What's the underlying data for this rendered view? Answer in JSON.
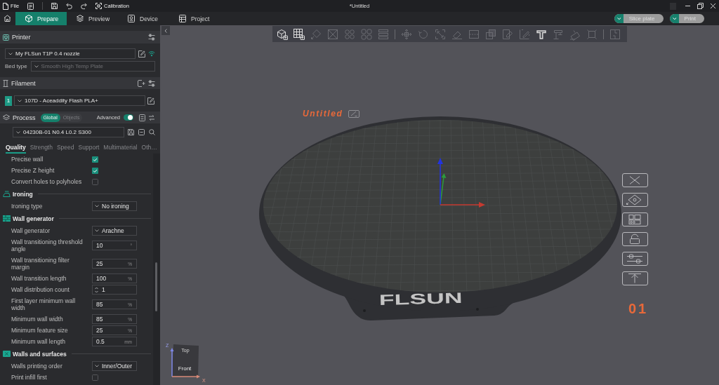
{
  "title_bar": {
    "menu": "File",
    "calibration": "Calibration",
    "title": "*Untitled"
  },
  "tabs": [
    {
      "label": "Prepare",
      "selected": true
    },
    {
      "label": "Preview",
      "selected": false
    },
    {
      "label": "Device",
      "selected": false
    },
    {
      "label": "Project",
      "selected": false
    }
  ],
  "actions": [
    {
      "label": "Slice plate",
      "disabled": true
    },
    {
      "label": "Print",
      "disabled": true
    }
  ],
  "printer": {
    "title": "Printer",
    "preset": "My FLSun T1P 0.4 nozzle",
    "bed_type": {
      "label": "Bed type",
      "value": "Smooth High Temp Plate",
      "disabled": true
    }
  },
  "filament": {
    "title": "Filament",
    "slots": [
      {
        "number": "1",
        "preset": "107D - Aceaddity Flash PLA+",
        "color": "#1e9a85"
      }
    ]
  },
  "process": {
    "title": "Process",
    "scopes": [
      {
        "label": "Global",
        "selected": true
      },
      {
        "label": "Objects",
        "selected": false
      }
    ],
    "advanced_label": "Advanced",
    "advanced": true,
    "preset": "04230B-01 N0.4 L0.2 S300"
  },
  "settings_tabs": [
    {
      "label": "Quality",
      "selected": true
    },
    {
      "label": "Strength",
      "selected": false
    },
    {
      "label": "Speed",
      "selected": false
    },
    {
      "label": "Support",
      "selected": false
    },
    {
      "label": "Multimaterial",
      "selected": false
    },
    {
      "label": "Oth…",
      "selected": false
    }
  ],
  "settings": [
    {
      "kind": "checkbox",
      "label": "Precise wall",
      "checked": true
    },
    {
      "kind": "checkbox",
      "label": "Precise Z height",
      "checked": true
    },
    {
      "kind": "checkbox",
      "label": "Convert holes to polyholes",
      "checked": false
    },
    {
      "kind": "section",
      "title": "Ironing"
    },
    {
      "kind": "dropdown",
      "label": "Ironing type",
      "value": "No ironing"
    },
    {
      "kind": "section",
      "title": "Wall generator"
    },
    {
      "kind": "dropdown",
      "label": "Wall generator",
      "value": "Arachne"
    },
    {
      "kind": "number",
      "label": "Wall transitioning threshold angle",
      "value": "10",
      "unit": "°"
    },
    {
      "kind": "number",
      "label": "Wall transitioning filter margin",
      "value": "25",
      "unit": "%"
    },
    {
      "kind": "number",
      "label": "Wall transition length",
      "value": "100",
      "unit": "%"
    },
    {
      "kind": "spin",
      "label": "Wall distribution count",
      "value": "1"
    },
    {
      "kind": "number",
      "label": "First layer minimum wall width",
      "value": "85",
      "unit": "%"
    },
    {
      "kind": "number",
      "label": "Minimum wall width",
      "value": "85",
      "unit": "%"
    },
    {
      "kind": "number",
      "label": "Minimum feature size",
      "value": "25",
      "unit": "%"
    },
    {
      "kind": "number",
      "label": "Minimum wall length",
      "value": "0.5",
      "unit": "mm"
    },
    {
      "kind": "section",
      "title": "Walls and surfaces"
    },
    {
      "kind": "dropdown",
      "label": "Walls printing order",
      "value": "Inner/Outer"
    },
    {
      "kind": "checkbox",
      "label": "Print infill first",
      "checked": false
    }
  ],
  "viewport": {
    "toolbar": [
      [
        {
          "disabled": false
        },
        {
          "disabled": false
        },
        {
          "disabled": true
        },
        {
          "disabled": true
        },
        {
          "disabled": true
        },
        {
          "disabled": true
        },
        {
          "disabled": true
        }
      ],
      [
        {
          "disabled": true
        },
        {
          "disabled": true
        },
        {
          "disabled": true
        },
        {
          "disabled": true
        },
        {
          "disabled": true
        },
        {
          "disabled": true
        },
        {
          "disabled": true
        },
        {
          "disabled": true
        },
        {
          "disabled": false
        },
        {
          "disabled": true
        },
        {
          "disabled": true
        },
        {
          "disabled": true
        }
      ],
      [
        {
          "disabled": true
        }
      ]
    ],
    "plate_name": "Untitled",
    "bed_logo": "FLSUN",
    "plate_number": "01",
    "side_tools": [
      {
        "disabled": false
      },
      {
        "disabled": false
      },
      {
        "disabled": false
      },
      {
        "disabled": false
      },
      {
        "disabled": false
      },
      {
        "disabled": false
      }
    ],
    "view_cube": {
      "top": "Top",
      "front": "Front",
      "z_label": "Z",
      "x_label": "X"
    }
  }
}
